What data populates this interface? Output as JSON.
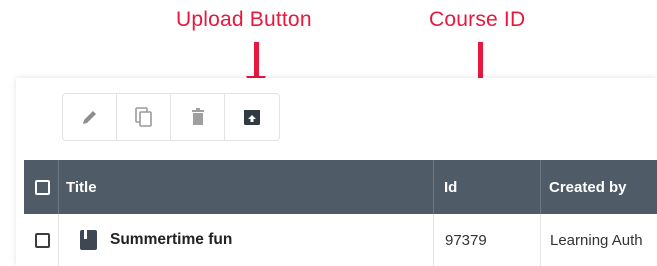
{
  "annotations": {
    "upload_button": "Upload Button",
    "course_id": "Course ID"
  },
  "toolbar": {
    "buttons": [
      {
        "icon": "pencil-icon",
        "action": "edit"
      },
      {
        "icon": "copy-icon",
        "action": "copy"
      },
      {
        "icon": "trash-icon",
        "action": "delete"
      },
      {
        "icon": "upload-icon",
        "action": "upload"
      }
    ]
  },
  "table": {
    "columns": [
      "Title",
      "Id",
      "Created by"
    ],
    "rows": [
      {
        "title": "Summertime fun",
        "id": "97379",
        "created_by": "Learning Auth"
      }
    ]
  },
  "colors": {
    "annotation": "#e8173c",
    "header_bg": "#4f5c67",
    "header_text": "#ffffff"
  }
}
